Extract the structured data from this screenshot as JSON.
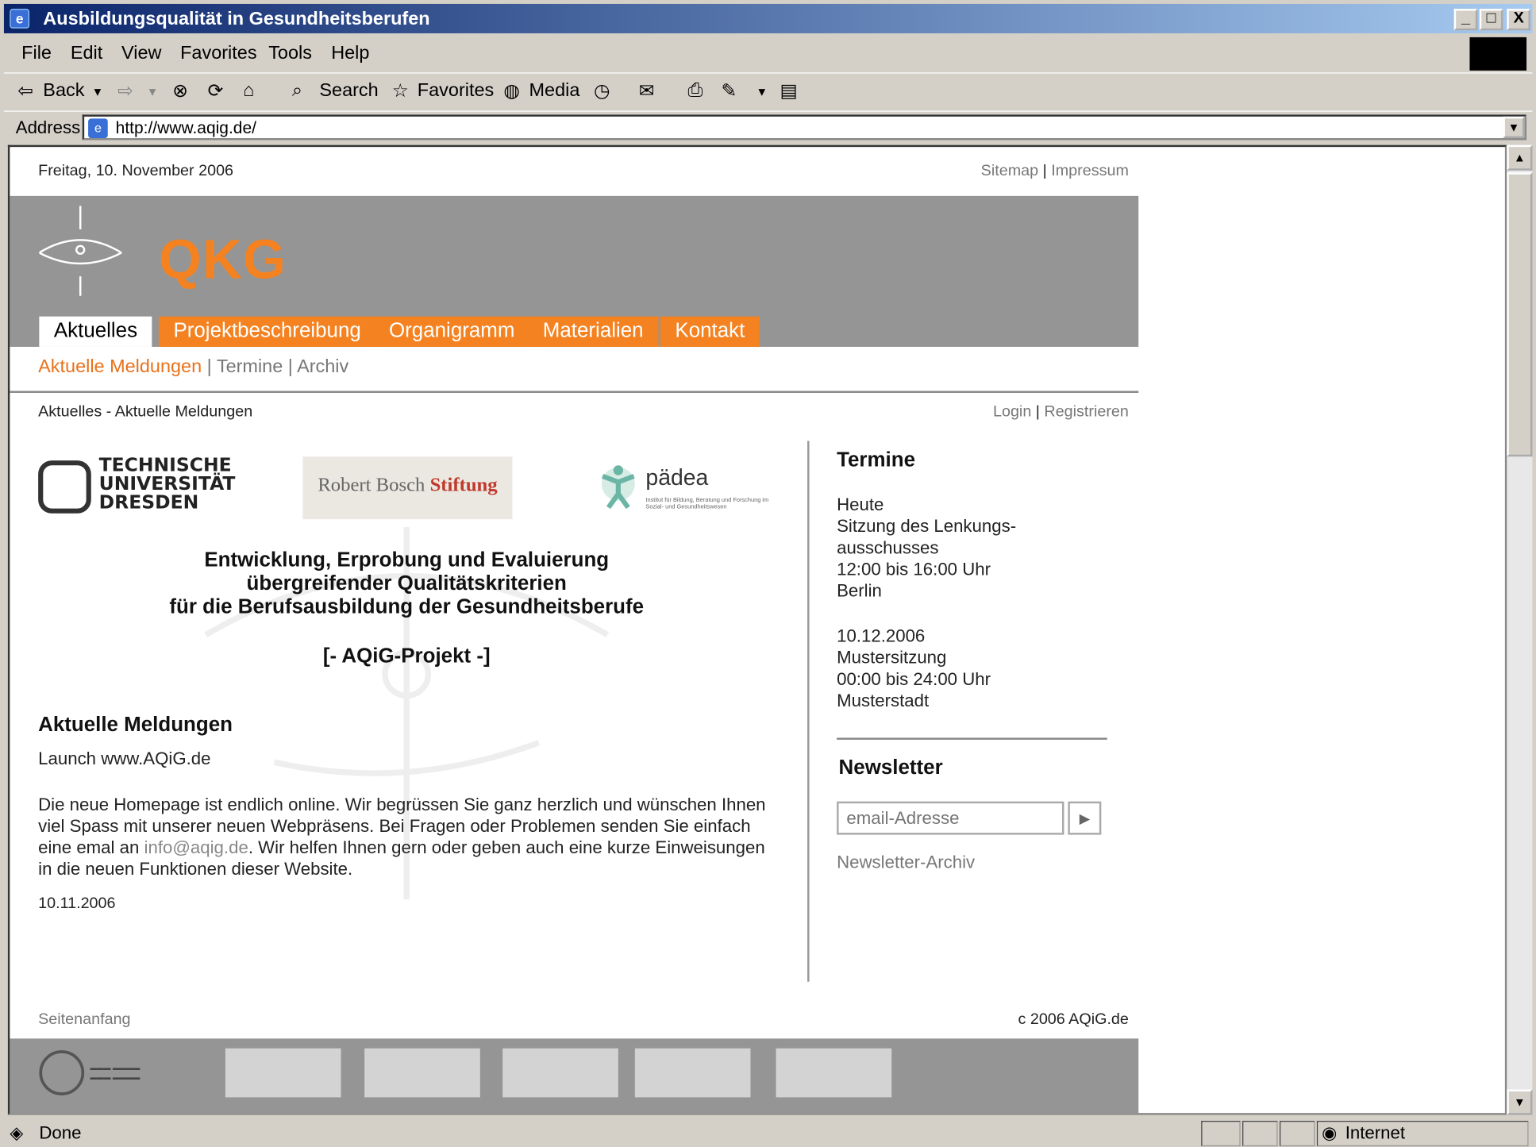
{
  "window": {
    "title": "Ausbildungsqualität in Gesundheitsberufen",
    "min_label": "_",
    "max_label": "□",
    "close_label": "X"
  },
  "menu": {
    "items": [
      "File",
      "Edit",
      "View",
      "Favorites",
      "Tools",
      "Help"
    ]
  },
  "toolbar": {
    "back": "Back",
    "search": "Search",
    "favorites": "Favorites",
    "media": "Media"
  },
  "address": {
    "label": "Address",
    "url": "http://www.aqig.de/"
  },
  "page": {
    "date": "Freitag, 10. November 2006",
    "toplinks": {
      "sitemap": "Sitemap",
      "sep": "|",
      "impressum": "Impressum"
    },
    "logo_text": "QKG",
    "nav_tabs": [
      "Aktuelles",
      "Projektbeschreibung",
      "Organigramm",
      "Materialien",
      "Kontakt"
    ],
    "active_tab": "Aktuelles",
    "subnav": {
      "current": "Aktuelle Meldungen",
      "sep": "|",
      "termine": "Termine",
      "archiv": "Archiv"
    },
    "breadcrumb": "Aktuelles  -  Aktuelle Meldungen",
    "login": "Login",
    "register": "Registrieren",
    "partners": {
      "tud_lines": [
        "TECHNISCHE",
        "UNIVERSITÄT",
        "DRESDEN"
      ],
      "rbs_plain": "Robert Bosch",
      "rbs_bold": "Stiftung",
      "paedea_name": "pädea",
      "paedea_sub": "Institut für Bildung, Beratung und Forschung im Sozial- und Gesundheitswesen"
    },
    "headline": [
      "Entwicklung, Erprobung und Evaluierung",
      "übergreifender Qualitätskriterien",
      "für die Berufsausbildung der Gesundheitsberufe"
    ],
    "project_tag": "[- AQiG-Projekt -]",
    "news": {
      "heading": "Aktuelle Meldungen",
      "title": "Launch www.AQiG.de",
      "body_1": "Die neue Homepage ist endlich online. Wir begrüssen Sie ganz herzlich und wünschen Ihnen viel Spass mit unserer neuen Webpräsens. Bei Fragen oder Problemen senden Sie einfach eine emal an ",
      "email": "info@aqig.de",
      "body_2": ". Wir helfen Ihnen gern oder geben auch eine kurze Einweisungen in die neuen Funktionen dieser Website.",
      "date": "10.11.2006"
    },
    "sidebar": {
      "termine_heading": "Termine",
      "events": [
        [
          "Heute",
          "Sitzung des Lenkungs-",
          "ausschusses",
          "12:00 bis 16:00 Uhr",
          "Berlin"
        ],
        [
          "10.12.2006",
          "Mustersitzung",
          "00:00 bis 24:00 Uhr",
          "Musterstadt"
        ]
      ],
      "newsletter_heading": "Newsletter",
      "email_placeholder": "email-Adresse",
      "go_label": "▶",
      "archive_link": "Newsletter-Archiv"
    },
    "footer": {
      "to_top": "Seitenanfang",
      "copyright": "c 2006 AQiG.de"
    }
  },
  "status": {
    "text": "Done",
    "zone": "Internet"
  },
  "colors": {
    "accent": "#f58220",
    "header_gray": "#959595"
  }
}
